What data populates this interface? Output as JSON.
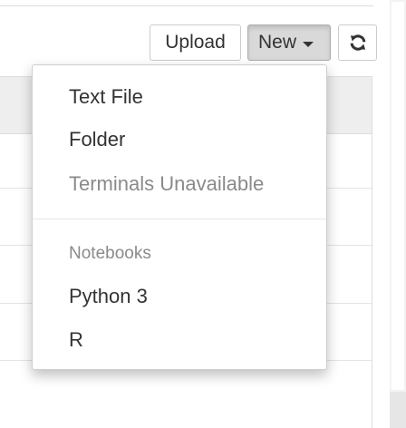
{
  "toolbar": {
    "upload_label": "Upload",
    "new_label": "New",
    "refresh_icon": "refresh-icon"
  },
  "new_menu": {
    "items": [
      {
        "label": "Text File",
        "enabled": true
      },
      {
        "label": "Folder",
        "enabled": true
      },
      {
        "label": "Terminals Unavailable",
        "enabled": false
      }
    ],
    "section_header": "Notebooks",
    "kernels": [
      {
        "label": "Python 3"
      },
      {
        "label": "R"
      }
    ]
  },
  "colors": {
    "menu_text": "#333333",
    "disabled_text": "#8a8a8a",
    "active_button_bg": "#d9d9d9",
    "list_header_bg": "#eeeeee"
  }
}
